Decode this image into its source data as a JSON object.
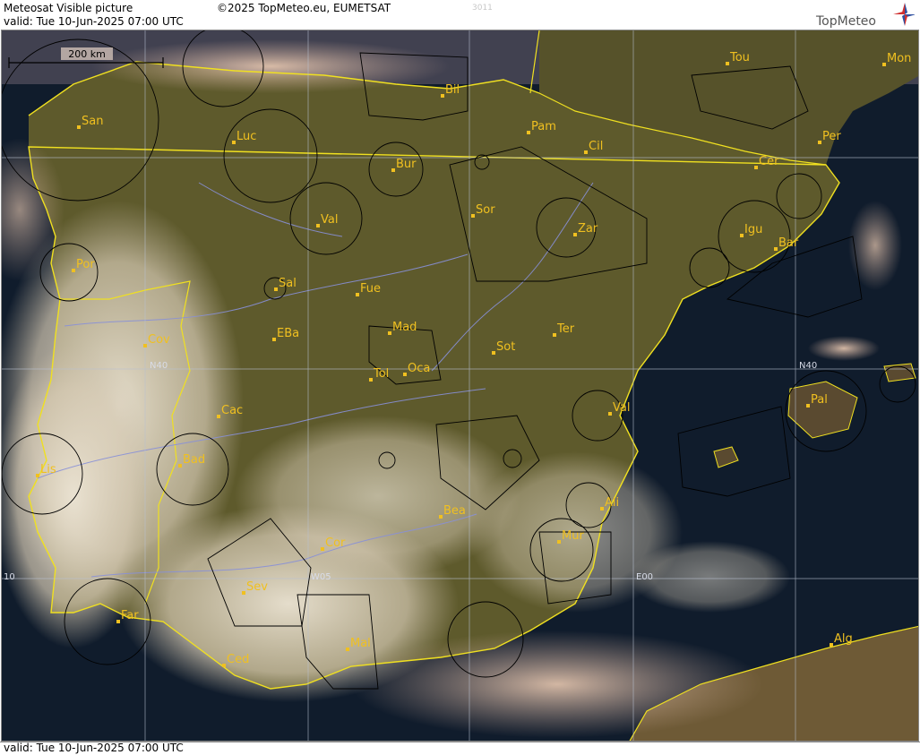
{
  "header": {
    "title": "Meteosat Visible picture",
    "valid": "valid:  Tue  10-Jun-2025  07:00 UTC",
    "copyright": "©2025 TopMeteo.eu, EUMETSAT",
    "code": "3011",
    "logo": "TopMeteo"
  },
  "scale_bar": {
    "label": "200 km"
  },
  "grid_labels": {
    "lat": "N40",
    "lon_w": "W05",
    "lon_e": "E00",
    "lon_w10": "10"
  },
  "cities": [
    {
      "id": "san",
      "name": "San"
    },
    {
      "id": "luc",
      "name": "Luc"
    },
    {
      "id": "bil",
      "name": "Bil"
    },
    {
      "id": "tou",
      "name": "Tou"
    },
    {
      "id": "mon",
      "name": "Mon"
    },
    {
      "id": "pam",
      "name": "Pam"
    },
    {
      "id": "per",
      "name": "Per"
    },
    {
      "id": "cil",
      "name": "Cil"
    },
    {
      "id": "bur",
      "name": "Bur"
    },
    {
      "id": "cer",
      "name": "Cer"
    },
    {
      "id": "val1",
      "name": "Val"
    },
    {
      "id": "sor",
      "name": "Sor"
    },
    {
      "id": "zar",
      "name": "Zar"
    },
    {
      "id": "igu",
      "name": "Igu"
    },
    {
      "id": "bar",
      "name": "Bar"
    },
    {
      "id": "por",
      "name": "Por"
    },
    {
      "id": "sal",
      "name": "Sal"
    },
    {
      "id": "fue",
      "name": "Fue"
    },
    {
      "id": "mad",
      "name": "Mad"
    },
    {
      "id": "cov",
      "name": "Cov"
    },
    {
      "id": "eba",
      "name": "EBa"
    },
    {
      "id": "ter",
      "name": "Ter"
    },
    {
      "id": "sot",
      "name": "Sot"
    },
    {
      "id": "tol",
      "name": "Tol"
    },
    {
      "id": "oca",
      "name": "Oca"
    },
    {
      "id": "pal",
      "name": "Pal"
    },
    {
      "id": "cac",
      "name": "Cac"
    },
    {
      "id": "val2",
      "name": "Val"
    },
    {
      "id": "bad",
      "name": "Bad"
    },
    {
      "id": "lis",
      "name": "Lis"
    },
    {
      "id": "bea",
      "name": "Bea"
    },
    {
      "id": "ali",
      "name": "Ali"
    },
    {
      "id": "cor",
      "name": "Cor"
    },
    {
      "id": "mur",
      "name": "Mur"
    },
    {
      "id": "sev",
      "name": "Sev"
    },
    {
      "id": "far",
      "name": "Far"
    },
    {
      "id": "mal",
      "name": "Mal"
    },
    {
      "id": "alg",
      "name": "Alg"
    },
    {
      "id": "ced",
      "name": "Ced"
    }
  ],
  "colors": {
    "land": "#5e5a2c",
    "sea": "#0f1a2a",
    "cloud": "#d9cfbd",
    "coast": "#f0e020",
    "label": "#f0c020",
    "river": "#8890d8",
    "grid": "#b8c0d0"
  }
}
